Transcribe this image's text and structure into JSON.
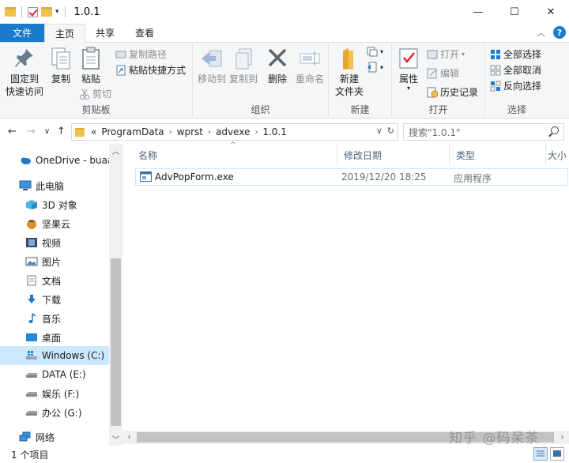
{
  "window": {
    "title": "1.0.1",
    "controls": {
      "minimize": "—",
      "maximize": "☐",
      "close": "✕"
    }
  },
  "tabs": [
    {
      "label": "文件"
    },
    {
      "label": "主页"
    },
    {
      "label": "共享"
    },
    {
      "label": "查看"
    }
  ],
  "ribbon": {
    "clipboard": {
      "label": "剪贴板",
      "pin": "固定到\n快速访问",
      "pin_l1": "固定到",
      "pin_l2": "快速访问",
      "copy": "复制",
      "paste": "粘贴",
      "copy_path": "复制路径",
      "paste_shortcut": "粘贴快捷方式",
      "cut": "剪切"
    },
    "organize": {
      "label": "组织",
      "move_to": "移动到",
      "copy_to": "复制到",
      "delete": "删除",
      "rename": "重命名"
    },
    "new": {
      "label": "新建",
      "new_folder_l1": "新建",
      "new_folder_l2": "文件夹"
    },
    "open": {
      "label": "打开",
      "properties": "属性",
      "open": "打开",
      "edit": "编辑",
      "history": "历史记录"
    },
    "select": {
      "label": "选择",
      "select_all": "全部选择",
      "select_none": "全部取消",
      "invert": "反向选择"
    }
  },
  "address": {
    "prefix": "«",
    "crumbs": [
      "ProgramData",
      "wprst",
      "advexe",
      "1.0.1"
    ],
    "search_placeholder": "搜索\"1.0.1\""
  },
  "nav": {
    "items": [
      {
        "label": "OneDrive - buaa",
        "icon": "cloud-icon"
      },
      {
        "label": "此电脑",
        "icon": "computer-icon"
      },
      {
        "label": "3D 对象",
        "icon": "cube-icon"
      },
      {
        "label": "坚果云",
        "icon": "nut-icon"
      },
      {
        "label": "视频",
        "icon": "video-icon"
      },
      {
        "label": "图片",
        "icon": "picture-icon"
      },
      {
        "label": "文档",
        "icon": "document-icon"
      },
      {
        "label": "下载",
        "icon": "download-icon"
      },
      {
        "label": "音乐",
        "icon": "music-icon"
      },
      {
        "label": "桌面",
        "icon": "desktop-icon"
      },
      {
        "label": "Windows (C:)",
        "icon": "windows-drive-icon"
      },
      {
        "label": "DATA (E:)",
        "icon": "drive-icon"
      },
      {
        "label": "娱乐 (F:)",
        "icon": "drive-icon"
      },
      {
        "label": "办公 (G:)",
        "icon": "drive-icon"
      },
      {
        "label": "网络",
        "icon": "network-icon"
      }
    ]
  },
  "columns": {
    "name": "名称",
    "date": "修改日期",
    "type": "类型",
    "size": "大小"
  },
  "files": [
    {
      "name": "AdvPopForm.exe",
      "date": "2019/12/20 18:25",
      "type": "应用程序",
      "icon": "exe-icon"
    }
  ],
  "status": {
    "count": "1 个项目"
  },
  "watermark": "知乎 @码呆茶",
  "colors": {
    "accent": "#1979ca",
    "selection": "#cce8ff"
  }
}
